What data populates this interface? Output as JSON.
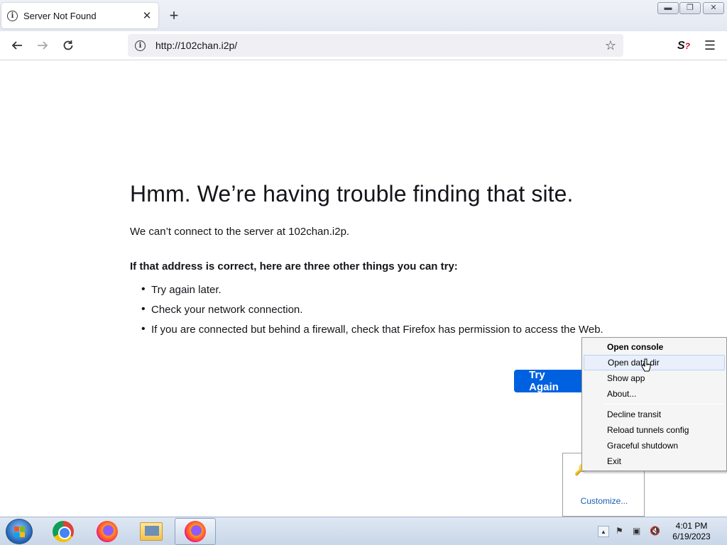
{
  "browser": {
    "tab": {
      "title": "Server Not Found"
    },
    "url": "http://102chan.i2p/"
  },
  "error_page": {
    "title": "Hmm. We’re having trouble finding that site.",
    "description": "We can’t connect to the server at 102chan.i2p.",
    "try_heading": "If that address is correct, here are three other things you can try:",
    "tips": [
      "Try again later.",
      "Check your network connection.",
      "If you are connected but behind a firewall, check that Firefox has permission to access the Web."
    ],
    "try_again_label": "Try Again"
  },
  "context_menu": {
    "items": [
      {
        "label": "Open console",
        "bold": true
      },
      {
        "label": "Open data dir",
        "hover": true
      },
      {
        "label": "Show app"
      },
      {
        "label": "About..."
      },
      {
        "label": "Decline transit"
      },
      {
        "label": "Reload tunnels config"
      },
      {
        "label": "Graceful shutdown"
      },
      {
        "label": "Exit"
      }
    ]
  },
  "tray_overflow": {
    "customize_label": "Customize..."
  },
  "taskbar": {
    "time": "4:01 PM",
    "date": "6/19/2023"
  },
  "colors": {
    "accent": "#0061e0",
    "menu_hover": "#e9f0fb"
  }
}
